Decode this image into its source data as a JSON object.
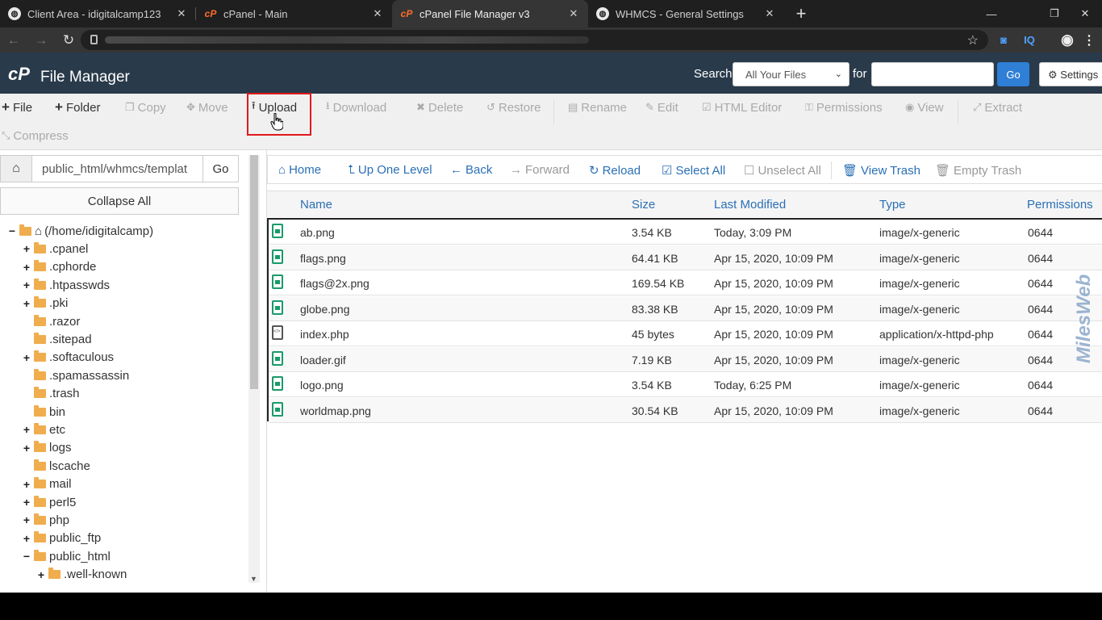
{
  "browser": {
    "tabs": [
      {
        "title": "Client Area - idigitalcamp123",
        "icon": "globe-icon",
        "active": false
      },
      {
        "title": "cPanel - Main",
        "icon": "cpanel-icon",
        "active": false
      },
      {
        "title": "cPanel File Manager v3",
        "icon": "cpanel-icon",
        "active": true
      },
      {
        "title": "WHMCS - General Settings",
        "icon": "globe-icon",
        "active": false
      }
    ],
    "extensions": [
      "IQ"
    ]
  },
  "header": {
    "logo": "cP",
    "title": "File Manager",
    "search_label": "Search",
    "search_scope": "All Your Files",
    "for_label": "for",
    "search_value": "",
    "go_label": "Go",
    "settings_label": "Settings"
  },
  "toolbar": {
    "file": "File",
    "folder": "Folder",
    "copy": "Copy",
    "move": "Move",
    "upload": "Upload",
    "download": "Download",
    "delete": "Delete",
    "restore": "Restore",
    "rename": "Rename",
    "edit": "Edit",
    "html_editor": "HTML Editor",
    "permissions": "Permissions",
    "view": "View",
    "extract": "Extract",
    "compress": "Compress"
  },
  "left": {
    "path": "public_html/whmcs/templat",
    "go_label": "Go",
    "collapse_label": "Collapse All",
    "tree": [
      {
        "label": "(/home/idigitalcamp)",
        "toggle": "−",
        "depth": 0,
        "kind": "home"
      },
      {
        "label": ".cpanel",
        "toggle": "+",
        "depth": 1
      },
      {
        "label": ".cphorde",
        "toggle": "+",
        "depth": 1
      },
      {
        "label": ".htpasswds",
        "toggle": "+",
        "depth": 1
      },
      {
        "label": ".pki",
        "toggle": "+",
        "depth": 1
      },
      {
        "label": ".razor",
        "toggle": "",
        "depth": 1
      },
      {
        "label": ".sitepad",
        "toggle": "",
        "depth": 1
      },
      {
        "label": ".softaculous",
        "toggle": "+",
        "depth": 1
      },
      {
        "label": ".spamassassin",
        "toggle": "",
        "depth": 1
      },
      {
        "label": ".trash",
        "toggle": "",
        "depth": 1
      },
      {
        "label": "bin",
        "toggle": "",
        "depth": 1
      },
      {
        "label": "etc",
        "toggle": "+",
        "depth": 1
      },
      {
        "label": "logs",
        "toggle": "+",
        "depth": 1
      },
      {
        "label": "lscache",
        "toggle": "",
        "depth": 1
      },
      {
        "label": "mail",
        "toggle": "+",
        "depth": 1
      },
      {
        "label": "perl5",
        "toggle": "+",
        "depth": 1
      },
      {
        "label": "php",
        "toggle": "+",
        "depth": 1
      },
      {
        "label": "public_ftp",
        "toggle": "+",
        "depth": 1
      },
      {
        "label": "public_html",
        "toggle": "−",
        "depth": 1
      },
      {
        "label": ".well-known",
        "toggle": "+",
        "depth": 2
      }
    ]
  },
  "nav": {
    "home": "Home",
    "up": "Up One Level",
    "back": "Back",
    "forward": "Forward",
    "reload": "Reload",
    "select_all": "Select All",
    "unselect_all": "Unselect All",
    "view_trash": "View Trash",
    "empty_trash": "Empty Trash"
  },
  "table": {
    "columns": [
      "Name",
      "Size",
      "Last Modified",
      "Type",
      "Permissions"
    ],
    "rows": [
      {
        "name": "ab.png",
        "size": "3.54 KB",
        "modified": "Today, 3:09 PM",
        "type": "image/x-generic",
        "perms": "0644",
        "icon": "image-file-icon"
      },
      {
        "name": "flags.png",
        "size": "64.41 KB",
        "modified": "Apr 15, 2020, 10:09 PM",
        "type": "image/x-generic",
        "perms": "0644",
        "icon": "image-file-icon"
      },
      {
        "name": "flags@2x.png",
        "size": "169.54 KB",
        "modified": "Apr 15, 2020, 10:09 PM",
        "type": "image/x-generic",
        "perms": "0644",
        "icon": "image-file-icon"
      },
      {
        "name": "globe.png",
        "size": "83.38 KB",
        "modified": "Apr 15, 2020, 10:09 PM",
        "type": "image/x-generic",
        "perms": "0644",
        "icon": "image-file-icon"
      },
      {
        "name": "index.php",
        "size": "45 bytes",
        "modified": "Apr 15, 2020, 10:09 PM",
        "type": "application/x-httpd-php",
        "perms": "0644",
        "icon": "code-file-icon"
      },
      {
        "name": "loader.gif",
        "size": "7.19 KB",
        "modified": "Apr 15, 2020, 10:09 PM",
        "type": "image/x-generic",
        "perms": "0644",
        "icon": "image-file-icon"
      },
      {
        "name": "logo.png",
        "size": "3.54 KB",
        "modified": "Today, 6:25 PM",
        "type": "image/x-generic",
        "perms": "0644",
        "icon": "image-file-icon"
      },
      {
        "name": "worldmap.png",
        "size": "30.54 KB",
        "modified": "Apr 15, 2020, 10:09 PM",
        "type": "image/x-generic",
        "perms": "0644",
        "icon": "image-file-icon"
      }
    ]
  },
  "watermark": "MilesWeb",
  "colors": {
    "header_bg": "#293a4a",
    "link": "#2a6fb5",
    "go_button": "#2f7fd6",
    "highlight": "#e0191c",
    "folder": "#f0ad4e",
    "file_icon": "#1a9a6a"
  }
}
